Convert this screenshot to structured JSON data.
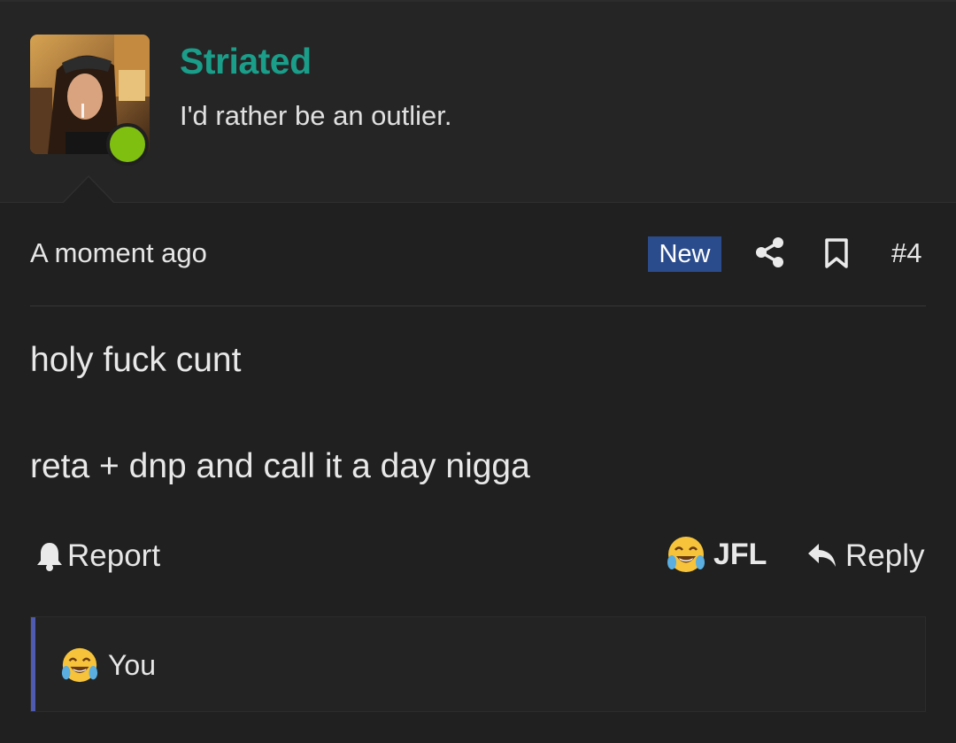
{
  "user": {
    "name": "Striated",
    "title": "I'd rather be an outlier.",
    "status": "online"
  },
  "post": {
    "time": "A moment ago",
    "badge": "New",
    "number": "#4",
    "lines": [
      "holy fuck cunt",
      "reta + dnp and call it a day nigga"
    ]
  },
  "actions": {
    "report": "Report",
    "reaction": "JFL",
    "reply": "Reply"
  },
  "reactions_summary": {
    "text": "You"
  },
  "icons": {
    "share": "share-icon",
    "bookmark": "bookmark-icon",
    "bell": "bell-icon",
    "reply": "reply-arrow-icon",
    "reaction": "laughing-tears-emoji"
  },
  "colors": {
    "username": "#1a9e8a",
    "online": "#7fbf10",
    "badge": "#2b4c8c",
    "accent": "#4e5bb0"
  }
}
